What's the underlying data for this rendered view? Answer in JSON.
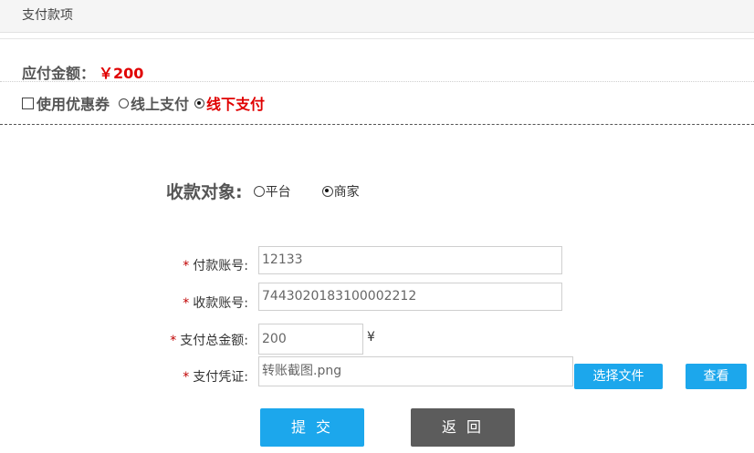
{
  "header": {
    "title": "支付款项"
  },
  "amount": {
    "label": "应付金额：",
    "value": "￥200"
  },
  "options": {
    "coupon_label": "使用优惠券",
    "online_label": "线上支付",
    "offline_label": "线下支付",
    "selected": "线下支付"
  },
  "payee": {
    "label": "收款对象:",
    "option_platform": "平台",
    "option_merchant": "商家",
    "selected": "商家"
  },
  "form": {
    "required_mark": "*",
    "pay_account_label": "付款账号:",
    "pay_account_value": "12133",
    "receive_account_label": "收款账号:",
    "receive_account_value": "7443020183100002212",
    "total_label": "支付总金额:",
    "total_value": "200",
    "total_unit": "¥",
    "voucher_label": "支付凭证:",
    "voucher_value": "转账截图.png",
    "choose_file_label": "选择文件",
    "view_label": "查看"
  },
  "actions": {
    "submit_label": "提 交",
    "back_label": "返 回"
  },
  "colors": {
    "accent": "#1ca7ec",
    "danger": "#e00000",
    "back_button": "#5c5c5c"
  }
}
